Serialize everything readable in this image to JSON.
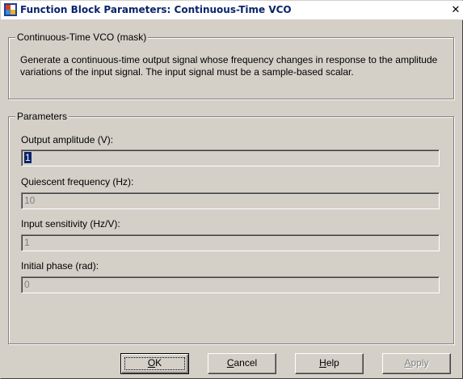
{
  "window": {
    "title": "Function Block Parameters: Continuous-Time VCO",
    "close_glyph": "✕"
  },
  "mask_group": {
    "legend": "Continuous-Time VCO (mask)",
    "description": "Generate a continuous-time output signal whose frequency changes in response to the amplitude variations of the input signal. The input signal must be a sample-based scalar."
  },
  "parameters": {
    "legend": "Parameters",
    "fields": [
      {
        "label": "Output amplitude (V):",
        "value": "1"
      },
      {
        "label": "Quiescent frequency (Hz):",
        "value": "10"
      },
      {
        "label": "Input sensitivity (Hz/V):",
        "value": "1"
      },
      {
        "label": "Initial phase (rad):",
        "value": "0"
      }
    ]
  },
  "buttons": {
    "ok": {
      "accel": "O",
      "rest": "K"
    },
    "cancel": {
      "accel": "C",
      "rest": "ancel"
    },
    "help": {
      "accel": "H",
      "rest": "elp"
    },
    "apply": {
      "accel": "A",
      "rest": "pply"
    }
  }
}
